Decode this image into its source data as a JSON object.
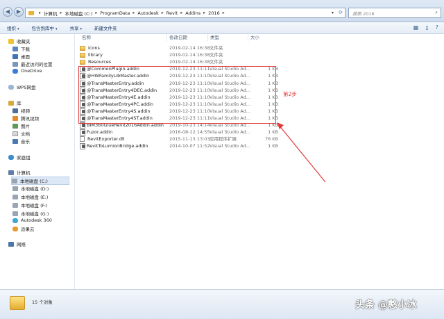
{
  "address": {
    "crumbs": [
      "计算机",
      "本地磁盘 (C:)",
      "ProgramData",
      "Autodesk",
      "Revit",
      "Addins",
      "2016"
    ],
    "search_placeholder": "搜索 2016"
  },
  "toolbar": {
    "organize": "组织",
    "include_library": "包含到库中",
    "share": "共享",
    "new_folder": "新建文件夹"
  },
  "sidebar": {
    "favorites": "收藏夹",
    "downloads": "下载",
    "desktop": "桌面",
    "recent": "最近访问的位置",
    "onedrive": "OneDrive",
    "wps": "WPS网盘",
    "library": "库",
    "videos": "视频",
    "tencent_video": "腾讯视频",
    "pictures": "图片",
    "documents": "文档",
    "music": "音乐",
    "homegroup": "家庭组",
    "computer": "计算机",
    "drive_c": "本地磁盘 (C:)",
    "drive_d": "本地磁盘 (D:)",
    "drive_e": "本地磁盘 (E:)",
    "drive_f": "本地磁盘 (F:)",
    "drive_g": "本地磁盘 (G:)",
    "autodesk360": "Autodesk 360",
    "cloud": "适果云",
    "network": "网络"
  },
  "columns": {
    "name": "名称",
    "date": "修改日期",
    "type": "类型",
    "size": "大小"
  },
  "files": [
    {
      "name": "icons",
      "date": "2019-02-14 16:38",
      "type": "文件夹",
      "size": "",
      "kind": "folder"
    },
    {
      "name": "library",
      "date": "2019-02-14 16:38",
      "type": "文件夹",
      "size": "",
      "kind": "folder"
    },
    {
      "name": "Resources",
      "date": "2019-02-14 16:38",
      "type": "文件夹",
      "size": "",
      "kind": "folder"
    },
    {
      "name": "@CommonPlugin.addin",
      "date": "2019-12-23 11:11",
      "type": "Visual Studio Ad...",
      "size": "1 KB",
      "kind": "addin"
    },
    {
      "name": "@HWFamilyLibMaster.addin",
      "date": "2019-12-23 11:10",
      "type": "Visual Studio Ad...",
      "size": "1 KB",
      "kind": "addin"
    },
    {
      "name": "@TransMasterEntry.addin",
      "date": "2019-12-23 11:10",
      "type": "Visual Studio Ad...",
      "size": "1 KB",
      "kind": "addin"
    },
    {
      "name": "@TransMasterEntry4DEC.addin",
      "date": "2019-12-23 11:10",
      "type": "Visual Studio Ad...",
      "size": "1 KB",
      "kind": "addin"
    },
    {
      "name": "@TransMasterEntry4E.addin",
      "date": "2019-12-23 11:10",
      "type": "Visual Studio Ad...",
      "size": "1 KB",
      "kind": "addin"
    },
    {
      "name": "@TransMasterEntry4PC.addin",
      "date": "2019-12-23 11:10",
      "type": "Visual Studio Ad...",
      "size": "1 KB",
      "kind": "addin"
    },
    {
      "name": "@TransMasterEntry4S.addin",
      "date": "2019-12-23 11:10",
      "type": "Visual Studio Ad...",
      "size": "1 KB",
      "kind": "addin"
    },
    {
      "name": "@TransMasterEntry4ST.addin",
      "date": "2019-12-23 11:11",
      "type": "Visual Studio Ad...",
      "size": "1 KB",
      "kind": "addin"
    },
    {
      "name": "BIM360GlueRevit2016Addin.addin",
      "date": "2019-10-23 14:14",
      "type": "Visual Studio Ad...",
      "size": "1 KB",
      "kind": "addin"
    },
    {
      "name": "Fuzor.addin",
      "date": "2016-08-12 14:55",
      "type": "Visual Studio Ad...",
      "size": "1 KB",
      "kind": "addin"
    },
    {
      "name": "RevitExporter.dll",
      "date": "2015-11-13 13:03",
      "type": "应用程序扩展",
      "size": "76 KB",
      "kind": "dll"
    },
    {
      "name": "RevitToLumionBridge.addin",
      "date": "2014-10-07 11:52",
      "type": "Visual Studio Ad...",
      "size": "1 KB",
      "kind": "addin"
    }
  ],
  "annotation": "第2步",
  "status": "15 个对象",
  "watermark": "头条 @憨小冰",
  "colors": {
    "highlight": "#e03a3a",
    "folder": "#e9b43a"
  }
}
